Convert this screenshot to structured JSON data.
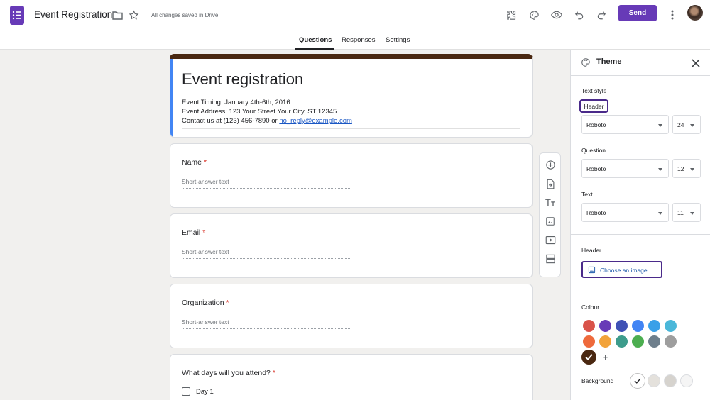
{
  "app": {
    "doc_title": "Event Registration",
    "saved_status": "All changes saved in Drive",
    "send_label": "Send",
    "brand_color": "#673ab7"
  },
  "tabs": [
    {
      "label": "Questions",
      "active": true
    },
    {
      "label": "Responses",
      "active": false
    },
    {
      "label": "Settings",
      "active": false
    }
  ],
  "form": {
    "title": "Event registration",
    "description": {
      "line1": "Event Timing: January 4th-6th, 2016",
      "line2": "Event Address: 123 Your Street Your City, ST 12345",
      "line3_prefix": "Contact us at (123) 456-7890 or ",
      "line3_link": "no_reply@example.com"
    },
    "header_color": "#4a2811",
    "questions": [
      {
        "title": "Name",
        "required": "*",
        "placeholder": "Short-answer text"
      },
      {
        "title": "Email",
        "required": "*",
        "placeholder": "Short-answer text"
      },
      {
        "title": "Organization",
        "required": "*",
        "placeholder": "Short-answer text"
      },
      {
        "title": "What days will you attend?",
        "required": "*",
        "option": "Day 1"
      }
    ]
  },
  "toolbar_icons": [
    "add-question-icon",
    "import-questions-icon",
    "add-title-icon",
    "add-image-icon",
    "add-video-icon",
    "add-section-icon"
  ],
  "theme": {
    "title": "Theme",
    "text_style_label": "Text style",
    "header_chip": "Header",
    "styles": [
      {
        "label": "",
        "font": "Roboto",
        "size": "24"
      },
      {
        "label": "Question",
        "font": "Roboto",
        "size": "12"
      },
      {
        "label": "Text",
        "font": "Roboto",
        "size": "11"
      }
    ],
    "header_section_label": "Header",
    "choose_image_label": "Choose an image",
    "colour_label": "Colour",
    "colours": [
      "#d9534a",
      "#673ab7",
      "#3f51b5",
      "#4285f4",
      "#3aa0e8",
      "#4ab7d9",
      "#ee6a3c",
      "#f2a33a",
      "#3d9c8c",
      "#4cae50",
      "#6e7f8c",
      "#9e9e9e",
      "#4a2811"
    ],
    "selected_colour": "#4a2811",
    "background_label": "Background",
    "backgrounds": [
      "#ffffff",
      "#e4e1dc",
      "#d6d3ce",
      "#f5f5f5"
    ]
  }
}
